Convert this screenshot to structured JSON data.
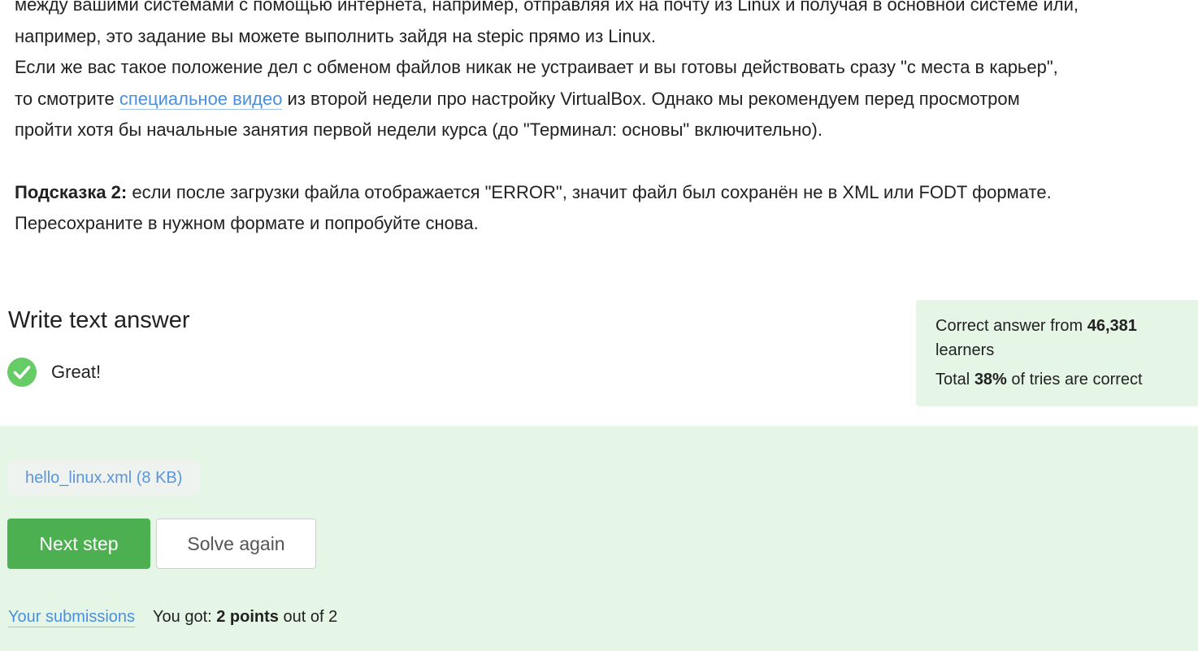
{
  "instructions": {
    "line1": "между вашими системами с помощью интернета, например, отправляя их на почту из Linux и получая в основной системе или,",
    "line2": "например, это задание вы можете выполнить зайдя на stepic прямо из Linux.",
    "line3": "Если же вас такое положение дел с обменом файлов никак не устраивает и вы готовы действовать сразу \"с места в карьер\",",
    "line4_before": "то смотрите ",
    "line4_link": "специальное видео",
    "line4_after": " из второй недели про настройку VirtualBox. Однако мы рекомендуем перед просмотром",
    "line5": "пройти хотя бы начальные занятия первой недели курса (до \"Терминал: основы\" включительно).",
    "hint_label": "Подсказка 2:",
    "hint_text": " если после загрузки файла отображается \"ERROR\", значит файл был сохранён не в XML или FODT формате.",
    "hint_line2": "Пересохраните в нужном формате и попробуйте снова."
  },
  "answer": {
    "title": "Write text answer",
    "result": "Great!",
    "result_icon": "check-circle-icon",
    "result_color": "#66cc66"
  },
  "stats": {
    "prefix": "Correct answer from ",
    "learners_count": "46,381",
    "learners_suffix": "learners",
    "total_prefix": "Total ",
    "percent": "38%",
    "total_suffix": " of tries are correct"
  },
  "feedback": {
    "file_name": "hello_linux.xml (8 KB)",
    "next_button": "Next step",
    "solve_again_button": "Solve again",
    "submissions_link": "Your submissions",
    "score_prefix": "You got: ",
    "score_points": "2 points",
    "score_suffix": " out of 2"
  },
  "colors": {
    "accent_green": "#4caf50",
    "panel_bg": "#e6f6e6",
    "link_blue": "#4a8fe0"
  }
}
